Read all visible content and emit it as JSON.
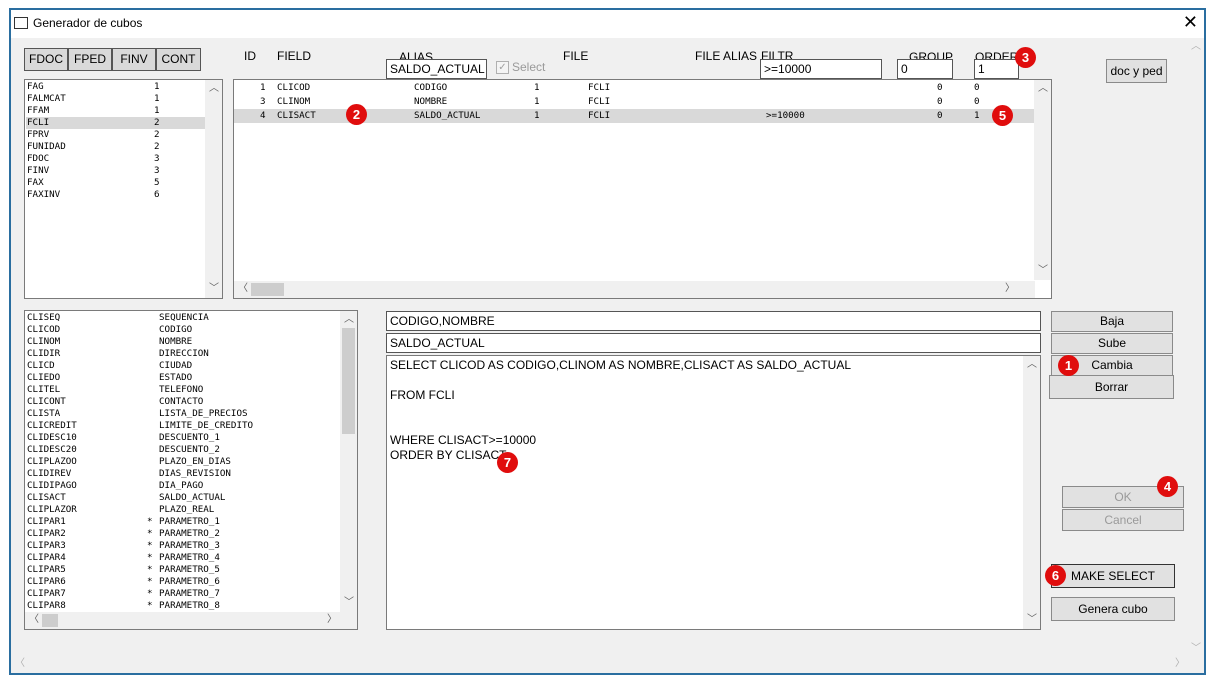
{
  "window": {
    "title": "Generador de cubos",
    "close": "✕"
  },
  "tabs": [
    "FDOC",
    "FPED",
    "FINV",
    "CONT"
  ],
  "headers": {
    "id": "ID",
    "field": "FIELD",
    "alias": "ALIAS",
    "file": "FILE",
    "file_alias": "FILE ALIAS",
    "filtr": "FILTR",
    "group": "GROUP",
    "order": "ORDER"
  },
  "inputs": {
    "alias": "SALDO_ACTUAL",
    "select_label": "Select",
    "filtr": ">=10000",
    "group": "0",
    "order": "1"
  },
  "doc_ped_button": "doc y ped",
  "file_list": [
    {
      "name": "FAG",
      "n": "1"
    },
    {
      "name": "FALMCAT",
      "n": "1"
    },
    {
      "name": "FFAM",
      "n": "1"
    },
    {
      "name": "FCLI",
      "n": "2"
    },
    {
      "name": "FPRV",
      "n": "2"
    },
    {
      "name": "FUNIDAD",
      "n": "2"
    },
    {
      "name": "FDOC",
      "n": "3"
    },
    {
      "name": "FINV",
      "n": "3"
    },
    {
      "name": "FAX",
      "n": "5"
    },
    {
      "name": "FAXINV",
      "n": "6"
    }
  ],
  "grid_rows": [
    {
      "id": "1",
      "field": "CLICOD",
      "alias": "CODIGO",
      "sel": "1",
      "file": "FCLI",
      "filtr": "",
      "group": "0",
      "order": "0"
    },
    {
      "id": "3",
      "field": "CLINOM",
      "alias": "NOMBRE",
      "sel": "1",
      "file": "FCLI",
      "filtr": "",
      "group": "0",
      "order": "0"
    },
    {
      "id": "4",
      "field": "CLISACT",
      "alias": "SALDO_ACTUAL",
      "sel": "1",
      "file": "FCLI",
      "filtr": ">=10000",
      "group": "0",
      "order": "1"
    }
  ],
  "field_list": [
    {
      "field": "CLISEQ",
      "mark": "",
      "desc": "SEQUENCIA"
    },
    {
      "field": "CLICOD",
      "mark": "",
      "desc": "CODIGO"
    },
    {
      "field": "CLINOM",
      "mark": "",
      "desc": "NOMBRE"
    },
    {
      "field": "CLIDIR",
      "mark": "",
      "desc": "DIRECCION"
    },
    {
      "field": "CLICD",
      "mark": "",
      "desc": "CIUDAD"
    },
    {
      "field": "CLIEDO",
      "mark": "",
      "desc": "ESTADO"
    },
    {
      "field": "CLITEL",
      "mark": "",
      "desc": "TELEFONO"
    },
    {
      "field": "CLICONT",
      "mark": "",
      "desc": "CONTACTO"
    },
    {
      "field": "CLISTA",
      "mark": "",
      "desc": "LISTA_DE_PRECIOS"
    },
    {
      "field": "CLICREDIT",
      "mark": "",
      "desc": "LIMITE_DE_CREDITO"
    },
    {
      "field": "CLIDESC10",
      "mark": "",
      "desc": "DESCUENTO_1"
    },
    {
      "field": "CLIDESC20",
      "mark": "",
      "desc": "DESCUENTO_2"
    },
    {
      "field": "CLIPLAZOO",
      "mark": "",
      "desc": "PLAZO_EN_DIAS"
    },
    {
      "field": "CLIDIREV",
      "mark": "",
      "desc": "DIAS_REVISION"
    },
    {
      "field": "CLIDIPAGO",
      "mark": "",
      "desc": "DIA_PAGO"
    },
    {
      "field": "CLISACT",
      "mark": "",
      "desc": "SALDO_ACTUAL"
    },
    {
      "field": "CLIPLAZOR",
      "mark": "",
      "desc": "PLAZO_REAL"
    },
    {
      "field": "CLIPAR1",
      "mark": "*",
      "desc": "PARAMETRO_1"
    },
    {
      "field": "CLIPAR2",
      "mark": "*",
      "desc": "PARAMETRO_2"
    },
    {
      "field": "CLIPAR3",
      "mark": "*",
      "desc": "PARAMETRO_3"
    },
    {
      "field": "CLIPAR4",
      "mark": "*",
      "desc": "PARAMETRO_4"
    },
    {
      "field": "CLIPAR5",
      "mark": "*",
      "desc": "PARAMETRO_5"
    },
    {
      "field": "CLIPAR6",
      "mark": "*",
      "desc": "PARAMETRO_6"
    },
    {
      "field": "CLIPAR7",
      "mark": "*",
      "desc": "PARAMETRO_7"
    },
    {
      "field": "CLIPAR8",
      "mark": "*",
      "desc": "PARAMETRO_8"
    }
  ],
  "group_fields": "CODIGO,NOMBRE",
  "order_fields": "SALDO_ACTUAL",
  "sql": {
    "line1": "SELECT CLICOD AS CODIGO,CLINOM AS NOMBRE,CLISACT AS SALDO_ACTUAL",
    "line2": "FROM FCLI",
    "line3": "WHERE CLISACT>=10000",
    "line4": "ORDER BY CLISACT"
  },
  "buttons": {
    "baja": "Baja",
    "sube": "Sube",
    "cambia": "Cambia",
    "borrar": "Borrar",
    "ok": "OK",
    "cancel": "Cancel",
    "make_select": "MAKE SELECT",
    "genera_cubo": "Genera cubo"
  },
  "badges": [
    "1",
    "2",
    "3",
    "4",
    "5",
    "6",
    "7"
  ],
  "colors": {
    "badge": "#e00d0d",
    "frame": "#2a6ea0",
    "selected_row": "#d9d9d9"
  }
}
